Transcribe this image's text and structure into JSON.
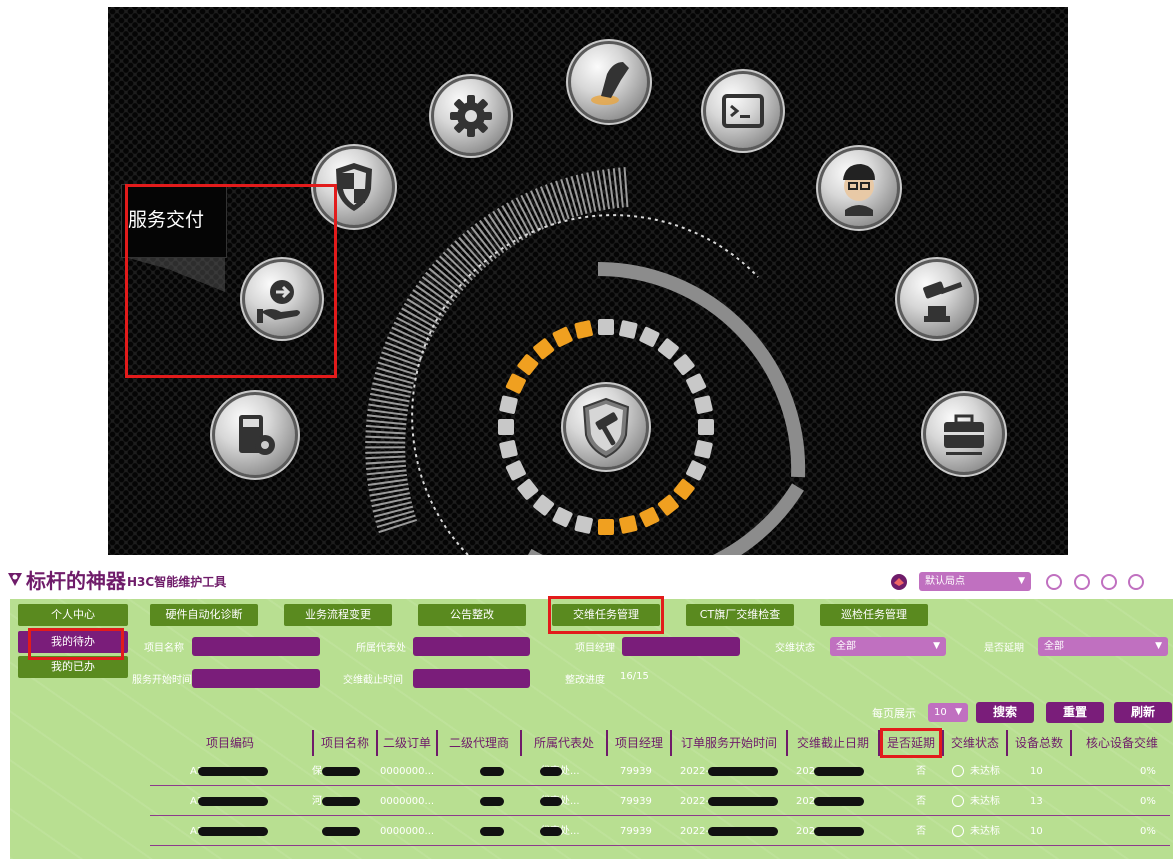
{
  "launcher": {
    "tooltip": "服务交付",
    "icons": [
      {
        "name": "shield-icon"
      },
      {
        "name": "gear-icon"
      },
      {
        "name": "hand-touch-icon"
      },
      {
        "name": "terminal-icon"
      },
      {
        "name": "engineer-avatar-icon"
      },
      {
        "name": "hammer-press-icon"
      },
      {
        "name": "toolbox-icon"
      },
      {
        "name": "service-delivery-icon"
      },
      {
        "name": "calculator-settings-icon"
      },
      {
        "name": "hammer-shield-icon"
      }
    ]
  },
  "app": {
    "title": "标杆的神器",
    "subtitle": "H3C智能维护工具",
    "site_select": "默认局点",
    "nav": [
      "硬件自动化诊断",
      "业务流程变更",
      "公告整改",
      "交维任务管理",
      "CT旗厂交维检查",
      "巡检任务管理"
    ],
    "sidebar": [
      "个人中心",
      "我的待办",
      "我的已办"
    ],
    "filters": {
      "project_name": "项目名称",
      "office": "所属代表处",
      "manager": "项目经理",
      "handover_status": "交维状态",
      "handover_status_value": "全部",
      "delayed": "是否延期",
      "delayed_value": "全部",
      "start_time": "服务开始时间",
      "deadline": "交维截止时间",
      "progress_label": "整改进度",
      "progress_value": "16/15"
    },
    "toolbar": {
      "per_page_label": "每页展示",
      "per_page_value": "10",
      "search": "搜索",
      "reset": "重置",
      "refresh": "刷新"
    },
    "table": {
      "headers": [
        "项目编码",
        "项目名称",
        "二级订单",
        "二级代理商",
        "所属代表处",
        "项目经理",
        "订单服务开始时间",
        "交维截止日期",
        "是否延期",
        "交维状态",
        "设备总数",
        "核心设备交维"
      ],
      "rows": [
        {
          "code": "A3H",
          "name": "保",
          "order": "0000000...",
          "office": "代表处...",
          "manager": "79939",
          "start": "2022-",
          "deadline": "202",
          "delayed": "否",
          "status": "未达标",
          "total": "10",
          "core": "0%"
        },
        {
          "code": "A3H",
          "name": "河",
          "order": "0000000...",
          "office": "代表处...",
          "manager": "79939",
          "start": "2022-",
          "deadline": "202",
          "delayed": "否",
          "status": "未达标",
          "total": "13",
          "core": "0%"
        },
        {
          "code": "A3",
          "name": "",
          "order": "0000000...",
          "office": "代表处...",
          "manager": "79939",
          "start": "2022-",
          "deadline": "202",
          "delayed": "否",
          "status": "未达标",
          "total": "10",
          "core": "0%"
        }
      ]
    }
  },
  "colors": {
    "brand_purple": "#6f1c6a",
    "nav_green": "#5a8a1f",
    "panel_green": "#b8df91",
    "highlight_red": "#e21b1b"
  }
}
